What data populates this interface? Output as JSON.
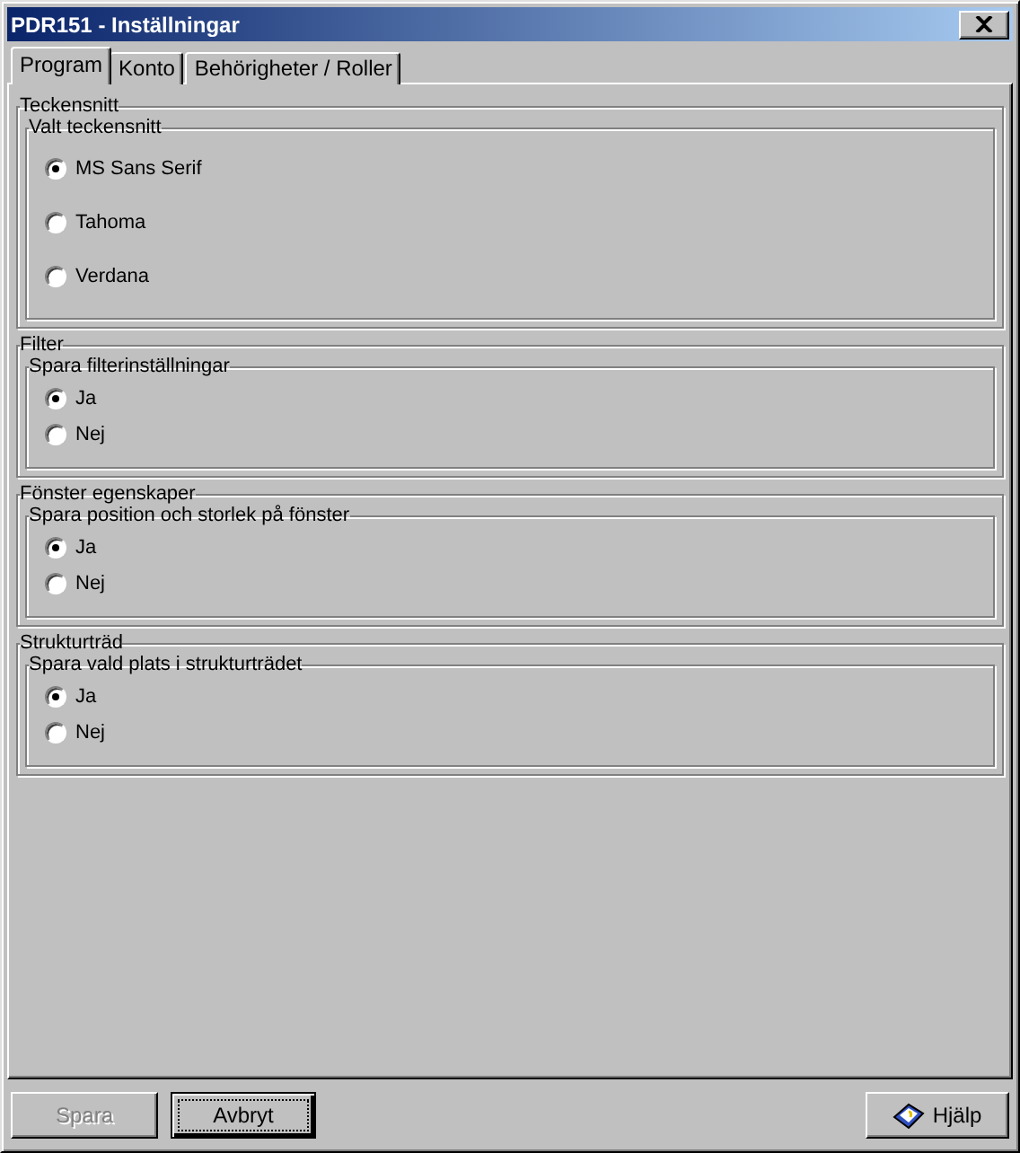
{
  "window": {
    "title": "PDR151 - Inställningar"
  },
  "tabs": [
    {
      "label": "Program",
      "selected": true
    },
    {
      "label": "Konto",
      "selected": false
    },
    {
      "label": "Behörigheter / Roller",
      "selected": false
    }
  ],
  "sections": [
    {
      "title": "Teckensnitt",
      "group_title": "Valt teckensnitt",
      "kind": "wide",
      "options": [
        {
          "label": "MS Sans Serif",
          "selected": true
        },
        {
          "label": "Tahoma",
          "selected": false
        },
        {
          "label": "Verdana",
          "selected": false
        }
      ]
    },
    {
      "title": "Filter",
      "group_title": "Spara filterinställningar",
      "kind": "compact",
      "options": [
        {
          "label": "Ja",
          "selected": true
        },
        {
          "label": "Nej",
          "selected": false
        }
      ]
    },
    {
      "title": "Fönster egenskaper",
      "group_title": "Spara position och storlek på fönster",
      "kind": "compact",
      "options": [
        {
          "label": "Ja",
          "selected": true
        },
        {
          "label": "Nej",
          "selected": false
        }
      ]
    },
    {
      "title": "Strukturträd",
      "group_title": "Spara vald plats i strukturträdet",
      "kind": "compact",
      "options": [
        {
          "label": "Ja",
          "selected": true
        },
        {
          "label": "Nej",
          "selected": false
        }
      ]
    }
  ],
  "buttons": [
    {
      "label": "Spara",
      "disabled": true,
      "focused": false
    },
    {
      "label": "Avbryt",
      "disabled": false,
      "focused": true
    }
  ],
  "help_button": {
    "label": "Hjälp"
  }
}
